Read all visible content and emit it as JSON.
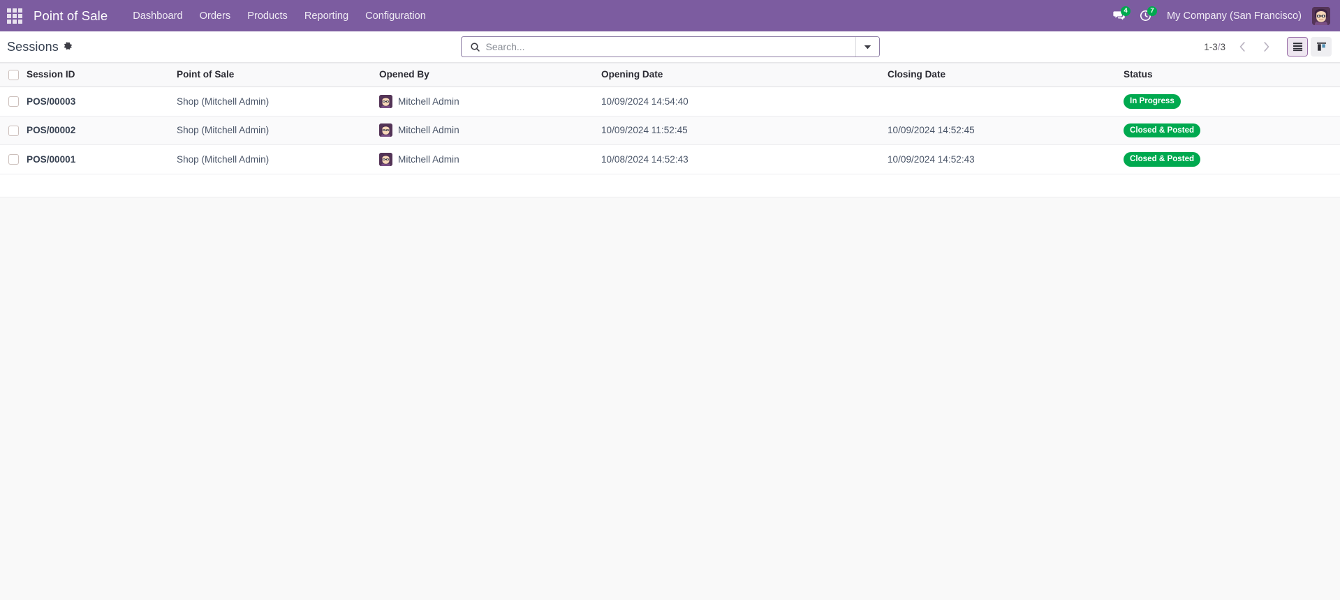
{
  "navbar": {
    "apps_icon": "apps-grid-icon",
    "brand": "Point of Sale",
    "menu": [
      {
        "label": "Dashboard"
      },
      {
        "label": "Orders"
      },
      {
        "label": "Products"
      },
      {
        "label": "Reporting"
      },
      {
        "label": "Configuration"
      }
    ],
    "messages": {
      "icon": "messages-icon",
      "count": "4"
    },
    "activities": {
      "icon": "activity-clock-icon",
      "count": "7"
    },
    "company": "My Company (San Francisco)",
    "avatar": "user-avatar",
    "background_color": "#7C5CA0",
    "badge_color": "#00A94F"
  },
  "control_panel": {
    "title": "Sessions",
    "settings_icon": "gear-icon",
    "search": {
      "icon": "search-icon",
      "placeholder": "Search...",
      "value": "",
      "dropdown_icon": "caret-down-icon"
    },
    "pager": {
      "range": "1-3",
      "separator": "/",
      "total": "3",
      "prev_icon": "chevron-left-icon",
      "next_icon": "chevron-right-icon"
    },
    "views": [
      {
        "name": "list",
        "icon": "list-view-icon",
        "active": true
      },
      {
        "name": "kanban",
        "icon": "kanban-view-icon",
        "active": false
      }
    ]
  },
  "list": {
    "columns": [
      {
        "key": "session_id",
        "label": "Session ID"
      },
      {
        "key": "point_of_sale",
        "label": "Point of Sale"
      },
      {
        "key": "opened_by",
        "label": "Opened By"
      },
      {
        "key": "opening_date",
        "label": "Opening Date"
      },
      {
        "key": "closing_date",
        "label": "Closing Date"
      },
      {
        "key": "status",
        "label": "Status"
      }
    ],
    "rows": [
      {
        "session_id": "POS/00003",
        "point_of_sale": "Shop (Mitchell Admin)",
        "opened_by": "Mitchell Admin",
        "opening_date": "10/09/2024 14:54:40",
        "closing_date": "",
        "status": "In Progress",
        "status_color": "#00A94F"
      },
      {
        "session_id": "POS/00002",
        "point_of_sale": "Shop (Mitchell Admin)",
        "opened_by": "Mitchell Admin",
        "opening_date": "10/09/2024 11:52:45",
        "closing_date": "10/09/2024 14:52:45",
        "status": "Closed & Posted",
        "status_color": "#00A94F"
      },
      {
        "session_id": "POS/00001",
        "point_of_sale": "Shop (Mitchell Admin)",
        "opened_by": "Mitchell Admin",
        "opening_date": "10/08/2024 14:52:43",
        "closing_date": "10/09/2024 14:52:43",
        "status": "Closed & Posted",
        "status_color": "#00A94F"
      }
    ]
  }
}
